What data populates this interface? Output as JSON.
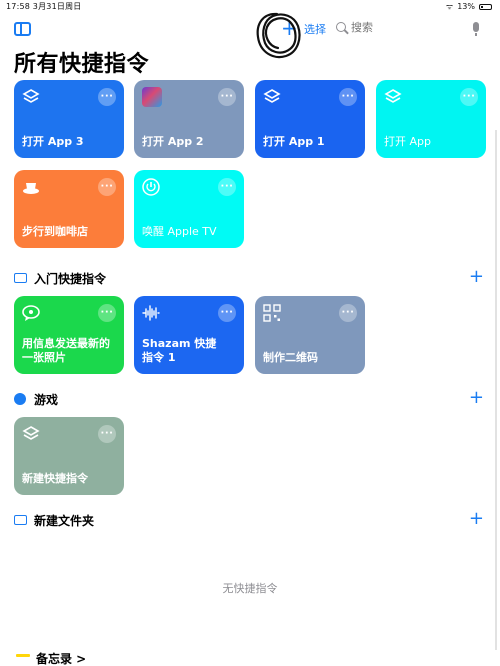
{
  "status_bar": {
    "time_date": "17:58  3月31日周日",
    "battery": "13%"
  },
  "toolbar": {
    "add_label": "+",
    "select_label": "选择",
    "search_placeholder": "搜索"
  },
  "page_title": "所有快捷指令",
  "cards": [
    {
      "title": "打开 App 3",
      "color": "#1e74ef",
      "icon": "layers-icon"
    },
    {
      "title": "打开 App 2",
      "color": "#7f98bc",
      "icon": "app-thumbnail"
    },
    {
      "title": "打开 App 1",
      "color": "#1a64f0",
      "icon": "layers-icon"
    },
    {
      "title": "打开 App",
      "color": "#00f5f2",
      "icon": "layers-icon"
    },
    {
      "title": "步行到咖啡店",
      "color": "#fc7d3a",
      "icon": "coffee-cup-icon"
    },
    {
      "title": "唤醒 Apple TV",
      "color": "#00fbf5",
      "icon": "power-icon"
    }
  ],
  "sections": {
    "getting_started": {
      "label": "入门快捷指令",
      "cards": [
        {
          "title": "用信息发送最新的\n一张照片",
          "color": "#1bd84c",
          "icon": "message-icon"
        },
        {
          "title": "Shazam 快捷\n指令 1",
          "color": "#1c67f1",
          "icon": "waveform-icon"
        },
        {
          "title": "制作二维码",
          "color": "#7f98bc",
          "icon": "qr-code-icon"
        }
      ]
    },
    "games": {
      "label": "游戏",
      "cards": [
        {
          "title": "新建快捷指令",
          "color": "#8fb09f",
          "icon": "layers-icon"
        }
      ]
    },
    "new_folder": {
      "label": "新建文件夹",
      "empty_text": "无快捷指令"
    }
  },
  "notes_bar": {
    "label": "备忘录 >"
  }
}
